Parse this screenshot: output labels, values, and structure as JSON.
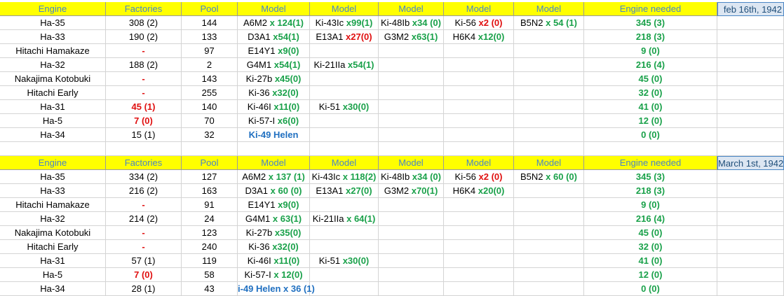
{
  "colors": {
    "header_bg": "#ffff00",
    "header_text": "#4a86c5",
    "green": "#1aa14a",
    "red": "#e01010",
    "blue": "#1f6fc0",
    "date_bg": "#dce6f2"
  },
  "headers": [
    "Engine",
    "Factories",
    "Pool",
    "Model",
    "Model",
    "Model",
    "Model",
    "Model",
    "Engine needed"
  ],
  "tables": [
    {
      "date": "feb 16th, 1942",
      "rows": [
        {
          "engine": "Ha-35",
          "factories": {
            "text": "308 (2)",
            "tone": "n"
          },
          "pool": "144",
          "models": [
            [
              {
                "t": "A6M2 "
              },
              {
                "t": "x 124(1)",
                "c": "g"
              }
            ],
            [
              {
                "t": "Ki-43Ic "
              },
              {
                "t": "x99(1)",
                "c": "g"
              }
            ],
            [
              {
                "t": "Ki-48Ib "
              },
              {
                "t": "x34 (0)",
                "c": "g"
              }
            ],
            [
              {
                "t": "Ki-56 "
              },
              {
                "t": "x2 (0)",
                "c": "r"
              }
            ],
            [
              {
                "t": "B5N2 "
              },
              {
                "t": "x 54 (1)",
                "c": "g"
              }
            ]
          ],
          "needed": "345 (3)"
        },
        {
          "engine": "Ha-33",
          "factories": {
            "text": "190 (2)",
            "tone": "n"
          },
          "pool": "133",
          "models": [
            [
              {
                "t": "D3A1 "
              },
              {
                "t": "x54(1)",
                "c": "g"
              }
            ],
            [
              {
                "t": "E13A1 "
              },
              {
                "t": "x27(0)",
                "c": "r"
              }
            ],
            [
              {
                "t": "G3M2 "
              },
              {
                "t": "x63(1)",
                "c": "g"
              }
            ],
            [
              {
                "t": "H6K4 "
              },
              {
                "t": "x12(0)",
                "c": "g"
              }
            ],
            []
          ],
          "needed": "218 (3)"
        },
        {
          "engine": "Hitachi Hamakaze",
          "factories": {
            "text": "-",
            "tone": "r"
          },
          "pool": "97",
          "models": [
            [
              {
                "t": "E14Y1 "
              },
              {
                "t": "x9(0)",
                "c": "g"
              }
            ],
            [],
            [],
            [],
            []
          ],
          "needed": "9 (0)"
        },
        {
          "engine": "Ha-32",
          "factories": {
            "text": "188 (2)",
            "tone": "n"
          },
          "pool": "2",
          "models": [
            [
              {
                "t": "G4M1 "
              },
              {
                "t": "x54(1)",
                "c": "g"
              }
            ],
            [
              {
                "t": "Ki-21IIa "
              },
              {
                "t": "x54(1)",
                "c": "g"
              }
            ],
            [],
            [],
            []
          ],
          "needed": "216 (4)"
        },
        {
          "engine": "Nakajima Kotobuki",
          "factories": {
            "text": "-",
            "tone": "r"
          },
          "pool": "143",
          "models": [
            [
              {
                "t": "Ki-27b "
              },
              {
                "t": "x45(0)",
                "c": "g"
              }
            ],
            [],
            [],
            [],
            []
          ],
          "needed": "45 (0)"
        },
        {
          "engine": "Hitachi Early",
          "factories": {
            "text": "-",
            "tone": "r"
          },
          "pool": "255",
          "models": [
            [
              {
                "t": "Ki-36 "
              },
              {
                "t": "x32(0)",
                "c": "g"
              }
            ],
            [],
            [],
            [],
            []
          ],
          "needed": "32 (0)"
        },
        {
          "engine": "Ha-31",
          "factories": {
            "text": "45 (1)",
            "tone": "r"
          },
          "pool": "140",
          "models": [
            [
              {
                "t": "Ki-46I "
              },
              {
                "t": "x11(0)",
                "c": "g"
              }
            ],
            [
              {
                "t": "Ki-51 "
              },
              {
                "t": "x30(0)",
                "c": "g"
              }
            ],
            [],
            [],
            []
          ],
          "needed": "41 (0)"
        },
        {
          "engine": "Ha-5",
          "factories": {
            "text": "7 (0)",
            "tone": "r"
          },
          "pool": "70",
          "models": [
            [
              {
                "t": "Ki-57-I "
              },
              {
                "t": "x6(0)",
                "c": "g"
              }
            ],
            [],
            [],
            [],
            []
          ],
          "needed": "12 (0)"
        },
        {
          "engine": "Ha-34",
          "factories": {
            "text": "15 (1)",
            "tone": "n"
          },
          "pool": "32",
          "models": [
            [
              {
                "t": "Ki-49 Helen",
                "c": "b",
                "center": true
              }
            ],
            [],
            [],
            [],
            []
          ],
          "needed": "0 (0)"
        }
      ]
    },
    {
      "date": "March 1st, 1942",
      "rows": [
        {
          "engine": "Ha-35",
          "factories": {
            "text": "334 (2)",
            "tone": "n"
          },
          "pool": "127",
          "models": [
            [
              {
                "t": "A6M2 "
              },
              {
                "t": "x 137 (1)",
                "c": "g"
              }
            ],
            [
              {
                "t": "Ki-43Ic "
              },
              {
                "t": "x 118(2)",
                "c": "g"
              }
            ],
            [
              {
                "t": "Ki-48Ib "
              },
              {
                "t": "x34 (0)",
                "c": "g"
              }
            ],
            [
              {
                "t": "Ki-56 "
              },
              {
                "t": "x2 (0)",
                "c": "r"
              }
            ],
            [
              {
                "t": "B5N2 "
              },
              {
                "t": "x 60 (0)",
                "c": "g"
              }
            ]
          ],
          "needed": "345 (3)"
        },
        {
          "engine": "Ha-33",
          "factories": {
            "text": "216 (2)",
            "tone": "n"
          },
          "pool": "163",
          "models": [
            [
              {
                "t": "D3A1 "
              },
              {
                "t": "x 60 (0)",
                "c": "g"
              }
            ],
            [
              {
                "t": "E13A1 "
              },
              {
                "t": "x27(0)",
                "c": "g"
              }
            ],
            [
              {
                "t": "G3M2 "
              },
              {
                "t": "x70(1)",
                "c": "g"
              }
            ],
            [
              {
                "t": "H6K4 "
              },
              {
                "t": "x20(0)",
                "c": "g"
              }
            ],
            []
          ],
          "needed": "218 (3)"
        },
        {
          "engine": "Hitachi Hamakaze",
          "factories": {
            "text": "-",
            "tone": "r"
          },
          "pool": "91",
          "models": [
            [
              {
                "t": "E14Y1 "
              },
              {
                "t": "x9(0)",
                "c": "g"
              }
            ],
            [],
            [],
            [],
            []
          ],
          "needed": "9 (0)"
        },
        {
          "engine": "Ha-32",
          "factories": {
            "text": "214 (2)",
            "tone": "n"
          },
          "pool": "24",
          "models": [
            [
              {
                "t": "G4M1 "
              },
              {
                "t": "x 63(1)",
                "c": "g"
              }
            ],
            [
              {
                "t": "Ki-21IIa "
              },
              {
                "t": "x 64(1)",
                "c": "g"
              }
            ],
            [],
            [],
            []
          ],
          "needed": "216 (4)"
        },
        {
          "engine": "Nakajima Kotobuki",
          "factories": {
            "text": "-",
            "tone": "r"
          },
          "pool": "123",
          "models": [
            [
              {
                "t": "Ki-27b "
              },
              {
                "t": "x35(0)",
                "c": "g"
              }
            ],
            [],
            [],
            [],
            []
          ],
          "needed": "45 (0)"
        },
        {
          "engine": "Hitachi Early",
          "factories": {
            "text": "-",
            "tone": "r"
          },
          "pool": "240",
          "models": [
            [
              {
                "t": "Ki-36 "
              },
              {
                "t": "x32(0)",
                "c": "g"
              }
            ],
            [],
            [],
            [],
            []
          ],
          "needed": "32 (0)"
        },
        {
          "engine": "Ha-31",
          "factories": {
            "text": "57 (1)",
            "tone": "n"
          },
          "pool": "119",
          "models": [
            [
              {
                "t": "Ki-46I "
              },
              {
                "t": "x11(0)",
                "c": "g"
              }
            ],
            [
              {
                "t": "Ki-51 "
              },
              {
                "t": "x30(0)",
                "c": "g"
              }
            ],
            [],
            [],
            []
          ],
          "needed": "41 (0)"
        },
        {
          "engine": "Ha-5",
          "factories": {
            "text": "7 (0)",
            "tone": "r"
          },
          "pool": "58",
          "models": [
            [
              {
                "t": "Ki-57-I "
              },
              {
                "t": "x 12(0)",
                "c": "g"
              }
            ],
            [],
            [],
            [],
            []
          ],
          "needed": "12 (0)"
        },
        {
          "engine": "Ha-34",
          "factories": {
            "text": "28 (1)",
            "tone": "n"
          },
          "pool": "43",
          "models": [
            [
              {
                "t": "i-49 Helen x 36 (1)",
                "c": "b",
                "overflow": true
              }
            ],
            [],
            [],
            [],
            []
          ],
          "needed": "0 (0)"
        }
      ]
    }
  ]
}
